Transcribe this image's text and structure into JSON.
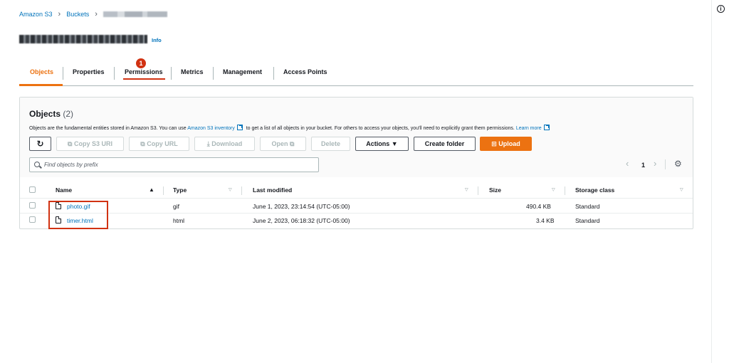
{
  "breadcrumb": {
    "home": "Amazon S3",
    "buckets": "Buckets",
    "separator": "›"
  },
  "header": {
    "info_label": "Info"
  },
  "tabs": [
    {
      "label": "Objects",
      "active": true
    },
    {
      "label": "Properties"
    },
    {
      "label": "Permissions",
      "badge": "1"
    },
    {
      "label": "Metrics"
    },
    {
      "label": "Management"
    },
    {
      "label": "Access Points"
    }
  ],
  "objects_panel": {
    "title": "Objects",
    "count": "(2)",
    "description_prefix": "Objects are the fundamental entities stored in Amazon S3. You can use ",
    "inventory_link": "Amazon S3 inventory",
    "description_mid": " to get a list of all objects in your bucket. For others to access your objects, you'll need to explicitly grant them permissions. ",
    "learn_more": "Learn more",
    "buttons": {
      "refresh": "↻",
      "copy_s3_uri": "Copy S3 URI",
      "copy_url": "Copy URL",
      "download": "Download",
      "open": "Open",
      "delete": "Delete",
      "actions": "Actions",
      "create_folder": "Create folder",
      "upload": "Upload"
    },
    "search_placeholder": "Find objects by prefix",
    "pagination": {
      "prev": "‹",
      "page": "1",
      "next": "›"
    },
    "columns": [
      "Name",
      "Type",
      "Last modified",
      "Size",
      "Storage class"
    ],
    "rows": [
      {
        "name": "photo.gif",
        "type": "gif",
        "last_modified": "June 1, 2023, 23:14:54 (UTC-05:00)",
        "size": "490.4 KB",
        "storage_class": "Standard"
      },
      {
        "name": "timer.html",
        "type": "html",
        "last_modified": "June 2, 2023, 06:18:32 (UTC-05:00)",
        "size": "3.4 KB",
        "storage_class": "Standard"
      }
    ]
  },
  "colors": {
    "accent": "#ec7211",
    "link": "#0073bb",
    "annotation": "#d13212"
  },
  "icons": [
    "info-circle-icon",
    "refresh-icon",
    "copy-icon",
    "download-icon",
    "external-link-icon",
    "caret-down-icon",
    "upload-icon",
    "search-icon",
    "gear-icon",
    "file-icon"
  ]
}
